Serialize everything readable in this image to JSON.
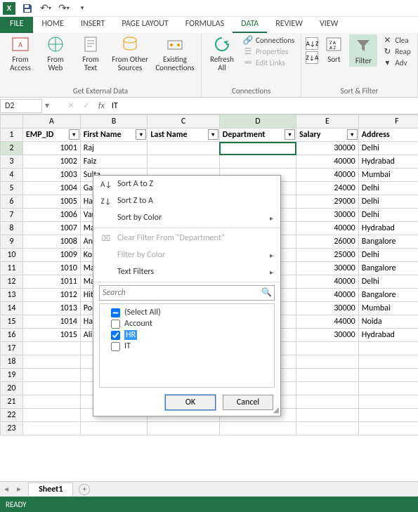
{
  "qat": {
    "save": "Save",
    "undo": "Undo",
    "redo": "Redo"
  },
  "tabs": {
    "file": "FILE",
    "items": [
      "HOME",
      "INSERT",
      "PAGE LAYOUT",
      "FORMULAS",
      "DATA",
      "REVIEW",
      "VIEW"
    ],
    "active": "DATA"
  },
  "ribbon": {
    "get_external": {
      "access": "From\nAccess",
      "web": "From\nWeb",
      "text": "From\nText",
      "other": "From Other\nSources",
      "existing": "Existing\nConnections",
      "label": "Get External Data"
    },
    "connections": {
      "refresh": "Refresh\nAll",
      "connections": "Connections",
      "properties": "Properties",
      "edit_links": "Edit Links",
      "label": "Connections"
    },
    "sort_filter": {
      "sort": "Sort",
      "filter": "Filter",
      "clear": "Clea",
      "reapply": "Reap",
      "advanced": "Adv",
      "label": "Sort & Filter"
    }
  },
  "namebox": "D2",
  "formula": "IT",
  "columns": [
    "A",
    "B",
    "C",
    "D",
    "E",
    "F"
  ],
  "headers": [
    "EMP_ID",
    "First Name",
    "Last Name",
    "Department",
    "Salary",
    "Address"
  ],
  "active_col_index": 3,
  "active_row": 2,
  "rows": [
    {
      "n": 2,
      "emp": "1001",
      "fn": "Raj",
      "sal": "30000",
      "addr": "Delhi"
    },
    {
      "n": 3,
      "emp": "1002",
      "fn": "Faiz",
      "sal": "40000",
      "addr": "Hydrabad"
    },
    {
      "n": 4,
      "emp": "1003",
      "fn": "Sulta",
      "sal": "40000",
      "addr": "Mumbai"
    },
    {
      "n": 5,
      "emp": "1004",
      "fn": "Gaur",
      "sal": "24000",
      "addr": "Delhi"
    },
    {
      "n": 6,
      "emp": "1005",
      "fn": "Harr",
      "sal": "29000",
      "addr": "Delhi"
    },
    {
      "n": 7,
      "emp": "1006",
      "fn": "Vars",
      "sal": "30000",
      "addr": "Delhi"
    },
    {
      "n": 8,
      "emp": "1007",
      "fn": "Mad",
      "sal": "40000",
      "addr": "Hydrabad"
    },
    {
      "n": 9,
      "emp": "1008",
      "fn": "Anu",
      "sal": "26000",
      "addr": "Bangalore"
    },
    {
      "n": 10,
      "emp": "1009",
      "fn": "Kom",
      "sal": "25000",
      "addr": "Delhi"
    },
    {
      "n": 11,
      "emp": "1010",
      "fn": "Man",
      "sal": "30000",
      "addr": "Bangalore"
    },
    {
      "n": 12,
      "emp": "1011",
      "fn": "Mah",
      "sal": "40000",
      "addr": "Delhi"
    },
    {
      "n": 13,
      "emp": "1012",
      "fn": "Hites",
      "sal": "40000",
      "addr": "Bangalore"
    },
    {
      "n": 14,
      "emp": "1013",
      "fn": "Pooj",
      "sal": "30000",
      "addr": "Mumbai"
    },
    {
      "n": 15,
      "emp": "1014",
      "fn": "Hars",
      "sal": "44000",
      "addr": "Noida"
    },
    {
      "n": 16,
      "emp": "1015",
      "fn": "Alina",
      "sal": "30000",
      "addr": "Hydrabad"
    }
  ],
  "empty_rows": [
    17,
    18,
    19,
    20,
    21,
    22,
    23
  ],
  "filter_popup": {
    "sort_az": "Sort A to Z",
    "sort_za": "Sort Z to A",
    "sort_color": "Sort by Color",
    "clear": "Clear Filter From \"Department\"",
    "filter_color": "Filter by Color",
    "text_filters": "Text Filters",
    "search_placeholder": "Search",
    "items": [
      {
        "label": "(Select All)",
        "checked": "indet"
      },
      {
        "label": "Account",
        "checked": false
      },
      {
        "label": "HR",
        "checked": true,
        "selected": true
      },
      {
        "label": "IT",
        "checked": false
      }
    ],
    "ok": "OK",
    "cancel": "Cancel"
  },
  "sheet_tab": "Sheet1",
  "status": "READY"
}
